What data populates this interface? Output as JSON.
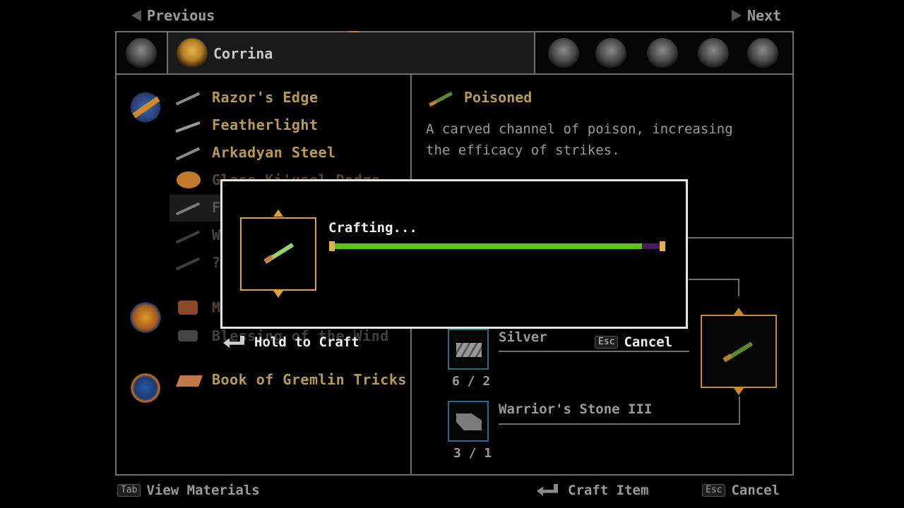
{
  "nav": {
    "previous_label": "Previous",
    "next_label": "Next"
  },
  "party": {
    "active_name": "Corrina"
  },
  "recipes": {
    "weapons": [
      {
        "name": "Razor's Edge",
        "dim": false
      },
      {
        "name": "Featherlight",
        "dim": false
      },
      {
        "name": "Arkadyan Steel",
        "dim": false
      },
      {
        "name": "Glass Ki'usel Dodge",
        "dim": true
      },
      {
        "name": "F",
        "dim": true
      },
      {
        "name": "W",
        "dim": true
      },
      {
        "name": "?",
        "dim": true
      }
    ],
    "armor": [
      {
        "name": "M",
        "dim": true
      },
      {
        "name": "Blessing of the Wind",
        "dim": true
      }
    ],
    "books": [
      {
        "name": "Book of Gremlin Tricks",
        "dim": false
      }
    ]
  },
  "detail": {
    "title": "Poisoned",
    "description_line1": "A carved channel of poison, increasing",
    "description_line2": "the efficacy of strikes.",
    "materials": [
      {
        "name": "Silver",
        "count": "6 / 2"
      },
      {
        "name": "Warrior's Stone III",
        "count": "3 / 1"
      }
    ]
  },
  "modal": {
    "status": "Crafting...",
    "progress": 0.93,
    "hold_label": "Hold to Craft",
    "cancel_key": "Esc",
    "cancel_label": "Cancel",
    "colors": {
      "bar_fill": "#5bc21f",
      "bar_track": "#4a1a5a",
      "bar_cap": "#e0b24a"
    }
  },
  "footer": {
    "tab_key": "Tab",
    "view_materials_label": "View Materials",
    "craft_label": "Craft Item",
    "esc_key": "Esc",
    "cancel_label": "Cancel"
  }
}
